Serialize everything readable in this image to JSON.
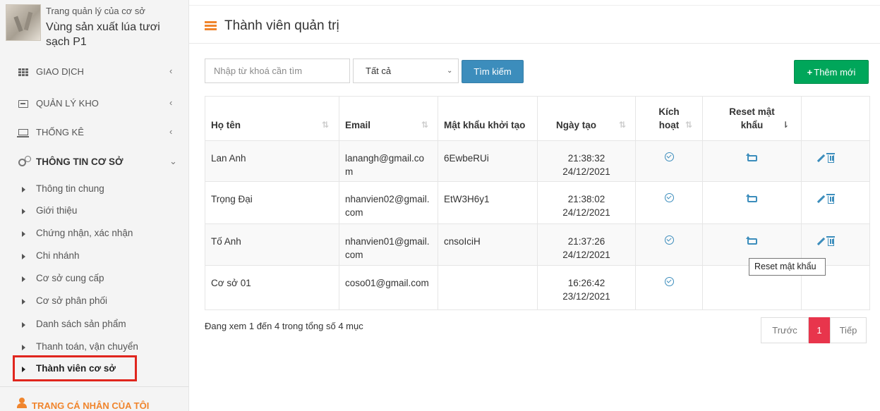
{
  "brand": {
    "subtitle": "Trang quản lý của cơ sở",
    "name": "Vùng sản xuất lúa tươi sạch P1"
  },
  "sidebar": {
    "menu": [
      {
        "label": "GIAO DỊCH",
        "icon": "grid-icon",
        "caret": "‹"
      },
      {
        "label": "QUẢN LÝ KHO",
        "icon": "box-icon",
        "caret": "‹"
      },
      {
        "label": "THỐNG KÊ",
        "icon": "monitor-icon",
        "caret": "‹"
      },
      {
        "label": "THÔNG TIN CƠ SỞ",
        "icon": "cogs-icon",
        "caret": "⌄"
      }
    ],
    "submenu": [
      {
        "label": "Thông tin chung"
      },
      {
        "label": "Giới thiệu"
      },
      {
        "label": "Chứng nhận, xác nhận"
      },
      {
        "label": "Chi nhánh"
      },
      {
        "label": "Cơ sở cung cấp"
      },
      {
        "label": "Cơ sở phân phối"
      },
      {
        "label": "Danh sách sản phẩm"
      },
      {
        "label": "Thanh toán, vận chuyển"
      },
      {
        "label": "Thành viên cơ sở"
      }
    ],
    "profile_link": "TRANG CÁ NHÂN CỦA TÔI"
  },
  "header": {
    "title": "Thành viên quản trị"
  },
  "toolbar": {
    "search_placeholder": "Nhập từ khoá cần tìm",
    "filter_value": "Tất cả",
    "search_label": "Tìm kiếm",
    "add_label": "Thêm mới"
  },
  "table": {
    "columns": [
      "Họ tên",
      "Email",
      "Mật khẩu khởi tạo",
      "Ngày tạo",
      "Kích hoạt",
      "Reset mật khẩu",
      ""
    ],
    "rows": [
      {
        "name": "Lan Anh",
        "email": "lanangh@gmail.com",
        "password": "6EwbeRUi",
        "time": "21:38:32",
        "date": "24/12/2021",
        "active": true,
        "reset": true,
        "actions": true
      },
      {
        "name": "Trọng Đại",
        "email": "nhanvien02@gmail.com",
        "password": "EtW3H6y1",
        "time": "21:38:02",
        "date": "24/12/2021",
        "active": true,
        "reset": true,
        "actions": true
      },
      {
        "name": "Tố Anh",
        "email": "nhanvien01@gmail.com",
        "password": "cnsoIciH",
        "time": "21:37:26",
        "date": "24/12/2021",
        "active": true,
        "reset": true,
        "actions": true
      },
      {
        "name": "Cơ sở 01",
        "email": "coso01@gmail.com",
        "password": "",
        "time": "16:26:42",
        "date": "23/12/2021",
        "active": true,
        "reset": false,
        "actions": false
      }
    ]
  },
  "tooltip": "Reset mật khẩu",
  "footer": {
    "info": "Đang xem 1 đến 4 trong tổng số 4 mục",
    "prev": "Trước",
    "page": "1",
    "next": "Tiếp"
  },
  "colors": {
    "accent_orange": "#f0852d",
    "primary_blue": "#3c8dbc",
    "success_green": "#00a65a",
    "page_active": "#e8354c",
    "highlight_red": "#e0261e"
  }
}
